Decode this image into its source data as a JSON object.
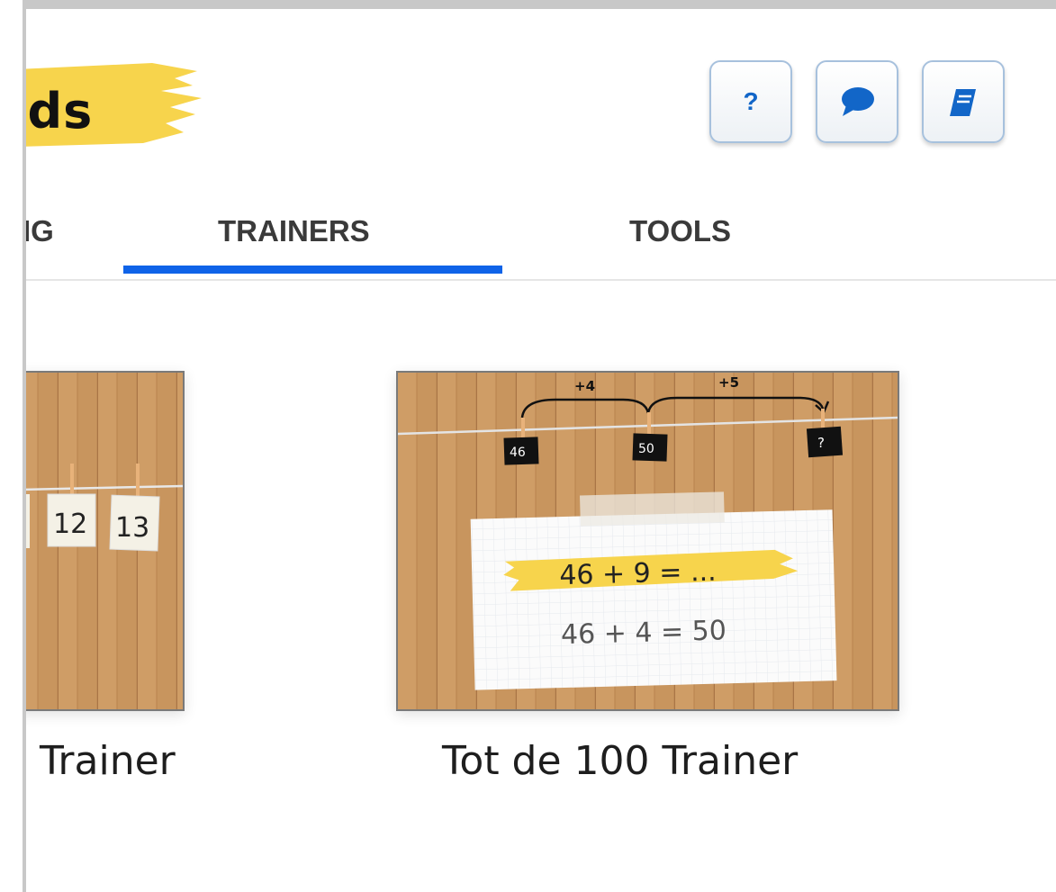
{
  "header": {
    "logo_text": "ids",
    "buttons": [
      {
        "name": "help",
        "icon": "question-icon",
        "label": "?"
      },
      {
        "name": "chat",
        "icon": "speech-bubble-icon"
      },
      {
        "name": "book",
        "icon": "book-icon"
      }
    ],
    "accent_color": "#1266c8"
  },
  "tabs": [
    {
      "label": "IG",
      "active": false
    },
    {
      "label": "TRAINERS",
      "active": true
    },
    {
      "label": "TOOLS",
      "active": false
    }
  ],
  "active_tab_color": "#0f63e8",
  "cards": [
    {
      "title": "Trainer",
      "thumbnail": {
        "cards": [
          "12",
          "13"
        ]
      }
    },
    {
      "title": "Tot de 100 Trainer",
      "thumbnail": {
        "jumps": [
          "+4",
          "+5"
        ],
        "tags": [
          "46",
          "50",
          "?"
        ],
        "highlight_equation": "46 + 9 = ...",
        "equation": "46 + 4 = 50"
      }
    }
  ]
}
